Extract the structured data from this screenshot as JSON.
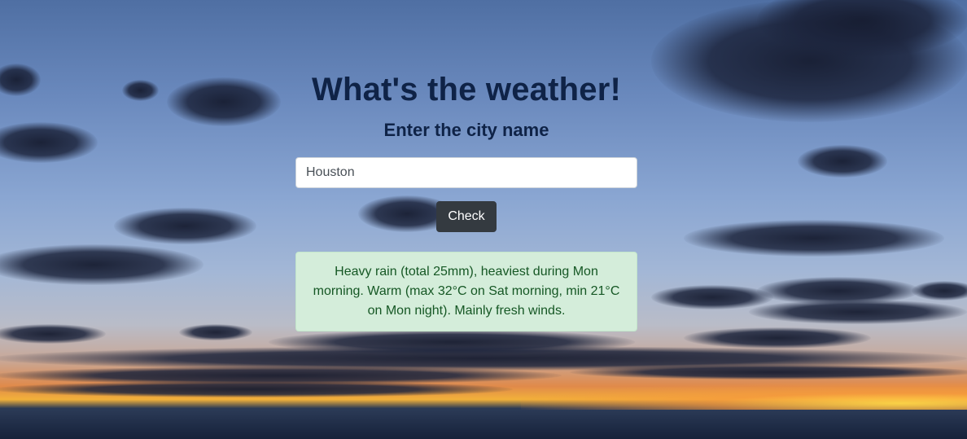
{
  "page": {
    "title": "What's the weather!",
    "subtitle": "Enter the city name"
  },
  "form": {
    "city_value": "Houston",
    "check_label": "Check"
  },
  "result": {
    "text": "Heavy rain (total 25mm), heaviest during Mon morning. Warm (max 32°C on Sat morning, min 21°C on Mon night). Mainly fresh winds."
  },
  "colors": {
    "heading": "#0f2347",
    "button": "#343a40",
    "alert_bg": "#d4edda",
    "alert_text": "#155724"
  }
}
